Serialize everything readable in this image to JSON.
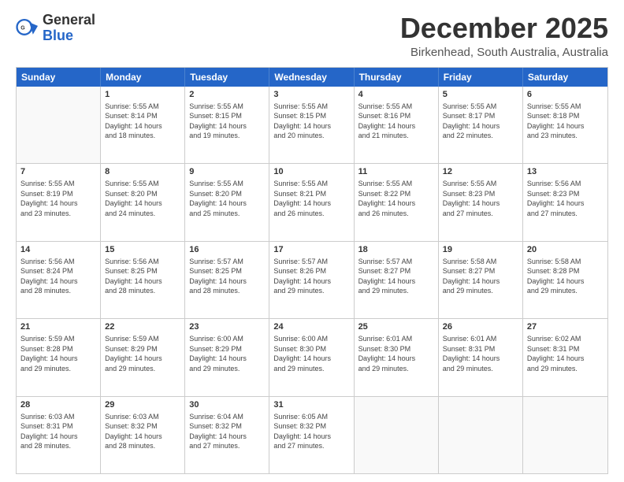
{
  "header": {
    "logo_general": "General",
    "logo_blue": "Blue",
    "title": "December 2025",
    "subtitle": "Birkenhead, South Australia, Australia"
  },
  "days_of_week": [
    "Sunday",
    "Monday",
    "Tuesday",
    "Wednesday",
    "Thursday",
    "Friday",
    "Saturday"
  ],
  "weeks": [
    [
      {
        "day": "",
        "info": ""
      },
      {
        "day": "1",
        "info": "Sunrise: 5:55 AM\nSunset: 8:14 PM\nDaylight: 14 hours\nand 18 minutes."
      },
      {
        "day": "2",
        "info": "Sunrise: 5:55 AM\nSunset: 8:15 PM\nDaylight: 14 hours\nand 19 minutes."
      },
      {
        "day": "3",
        "info": "Sunrise: 5:55 AM\nSunset: 8:15 PM\nDaylight: 14 hours\nand 20 minutes."
      },
      {
        "day": "4",
        "info": "Sunrise: 5:55 AM\nSunset: 8:16 PM\nDaylight: 14 hours\nand 21 minutes."
      },
      {
        "day": "5",
        "info": "Sunrise: 5:55 AM\nSunset: 8:17 PM\nDaylight: 14 hours\nand 22 minutes."
      },
      {
        "day": "6",
        "info": "Sunrise: 5:55 AM\nSunset: 8:18 PM\nDaylight: 14 hours\nand 23 minutes."
      }
    ],
    [
      {
        "day": "7",
        "info": "Sunrise: 5:55 AM\nSunset: 8:19 PM\nDaylight: 14 hours\nand 23 minutes."
      },
      {
        "day": "8",
        "info": "Sunrise: 5:55 AM\nSunset: 8:20 PM\nDaylight: 14 hours\nand 24 minutes."
      },
      {
        "day": "9",
        "info": "Sunrise: 5:55 AM\nSunset: 8:20 PM\nDaylight: 14 hours\nand 25 minutes."
      },
      {
        "day": "10",
        "info": "Sunrise: 5:55 AM\nSunset: 8:21 PM\nDaylight: 14 hours\nand 26 minutes."
      },
      {
        "day": "11",
        "info": "Sunrise: 5:55 AM\nSunset: 8:22 PM\nDaylight: 14 hours\nand 26 minutes."
      },
      {
        "day": "12",
        "info": "Sunrise: 5:55 AM\nSunset: 8:23 PM\nDaylight: 14 hours\nand 27 minutes."
      },
      {
        "day": "13",
        "info": "Sunrise: 5:56 AM\nSunset: 8:23 PM\nDaylight: 14 hours\nand 27 minutes."
      }
    ],
    [
      {
        "day": "14",
        "info": "Sunrise: 5:56 AM\nSunset: 8:24 PM\nDaylight: 14 hours\nand 28 minutes."
      },
      {
        "day": "15",
        "info": "Sunrise: 5:56 AM\nSunset: 8:25 PM\nDaylight: 14 hours\nand 28 minutes."
      },
      {
        "day": "16",
        "info": "Sunrise: 5:57 AM\nSunset: 8:25 PM\nDaylight: 14 hours\nand 28 minutes."
      },
      {
        "day": "17",
        "info": "Sunrise: 5:57 AM\nSunset: 8:26 PM\nDaylight: 14 hours\nand 29 minutes."
      },
      {
        "day": "18",
        "info": "Sunrise: 5:57 AM\nSunset: 8:27 PM\nDaylight: 14 hours\nand 29 minutes."
      },
      {
        "day": "19",
        "info": "Sunrise: 5:58 AM\nSunset: 8:27 PM\nDaylight: 14 hours\nand 29 minutes."
      },
      {
        "day": "20",
        "info": "Sunrise: 5:58 AM\nSunset: 8:28 PM\nDaylight: 14 hours\nand 29 minutes."
      }
    ],
    [
      {
        "day": "21",
        "info": "Sunrise: 5:59 AM\nSunset: 8:28 PM\nDaylight: 14 hours\nand 29 minutes."
      },
      {
        "day": "22",
        "info": "Sunrise: 5:59 AM\nSunset: 8:29 PM\nDaylight: 14 hours\nand 29 minutes."
      },
      {
        "day": "23",
        "info": "Sunrise: 6:00 AM\nSunset: 8:29 PM\nDaylight: 14 hours\nand 29 minutes."
      },
      {
        "day": "24",
        "info": "Sunrise: 6:00 AM\nSunset: 8:30 PM\nDaylight: 14 hours\nand 29 minutes."
      },
      {
        "day": "25",
        "info": "Sunrise: 6:01 AM\nSunset: 8:30 PM\nDaylight: 14 hours\nand 29 minutes."
      },
      {
        "day": "26",
        "info": "Sunrise: 6:01 AM\nSunset: 8:31 PM\nDaylight: 14 hours\nand 29 minutes."
      },
      {
        "day": "27",
        "info": "Sunrise: 6:02 AM\nSunset: 8:31 PM\nDaylight: 14 hours\nand 29 minutes."
      }
    ],
    [
      {
        "day": "28",
        "info": "Sunrise: 6:03 AM\nSunset: 8:31 PM\nDaylight: 14 hours\nand 28 minutes."
      },
      {
        "day": "29",
        "info": "Sunrise: 6:03 AM\nSunset: 8:32 PM\nDaylight: 14 hours\nand 28 minutes."
      },
      {
        "day": "30",
        "info": "Sunrise: 6:04 AM\nSunset: 8:32 PM\nDaylight: 14 hours\nand 27 minutes."
      },
      {
        "day": "31",
        "info": "Sunrise: 6:05 AM\nSunset: 8:32 PM\nDaylight: 14 hours\nand 27 minutes."
      },
      {
        "day": "",
        "info": ""
      },
      {
        "day": "",
        "info": ""
      },
      {
        "day": "",
        "info": ""
      }
    ]
  ]
}
